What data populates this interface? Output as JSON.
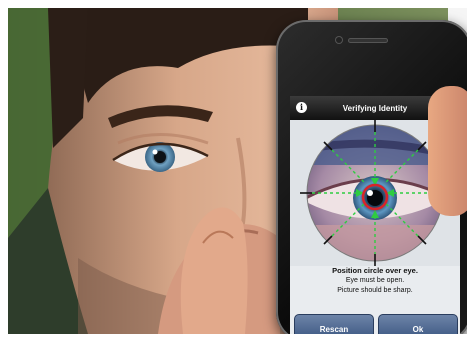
{
  "app": {
    "title": "Verifying Identity"
  },
  "icons": {
    "info": "info-icon",
    "settings": "settings-icon"
  },
  "instructions": {
    "heading": "Position circle over eye.",
    "line1": "Eye must be open.",
    "line2": "Picture should be sharp."
  },
  "buttons": {
    "rescan": "Rescan",
    "ok": "Ok"
  },
  "colors": {
    "target_ring": "#d8242a",
    "guide_lines": "#2ecc40",
    "button": "#4c6a96"
  }
}
